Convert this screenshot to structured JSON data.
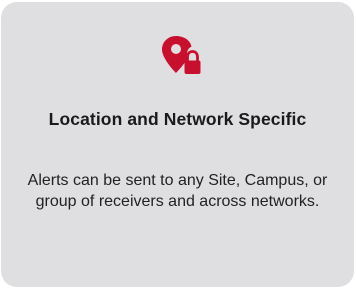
{
  "card": {
    "icon": "location-lock-icon",
    "accent_color": "#c8102e",
    "background_color": "#dfdfe1",
    "title": "Location and Network Specific",
    "description": "Alerts can be sent to any Site, Campus, or group of receivers and across networks."
  }
}
